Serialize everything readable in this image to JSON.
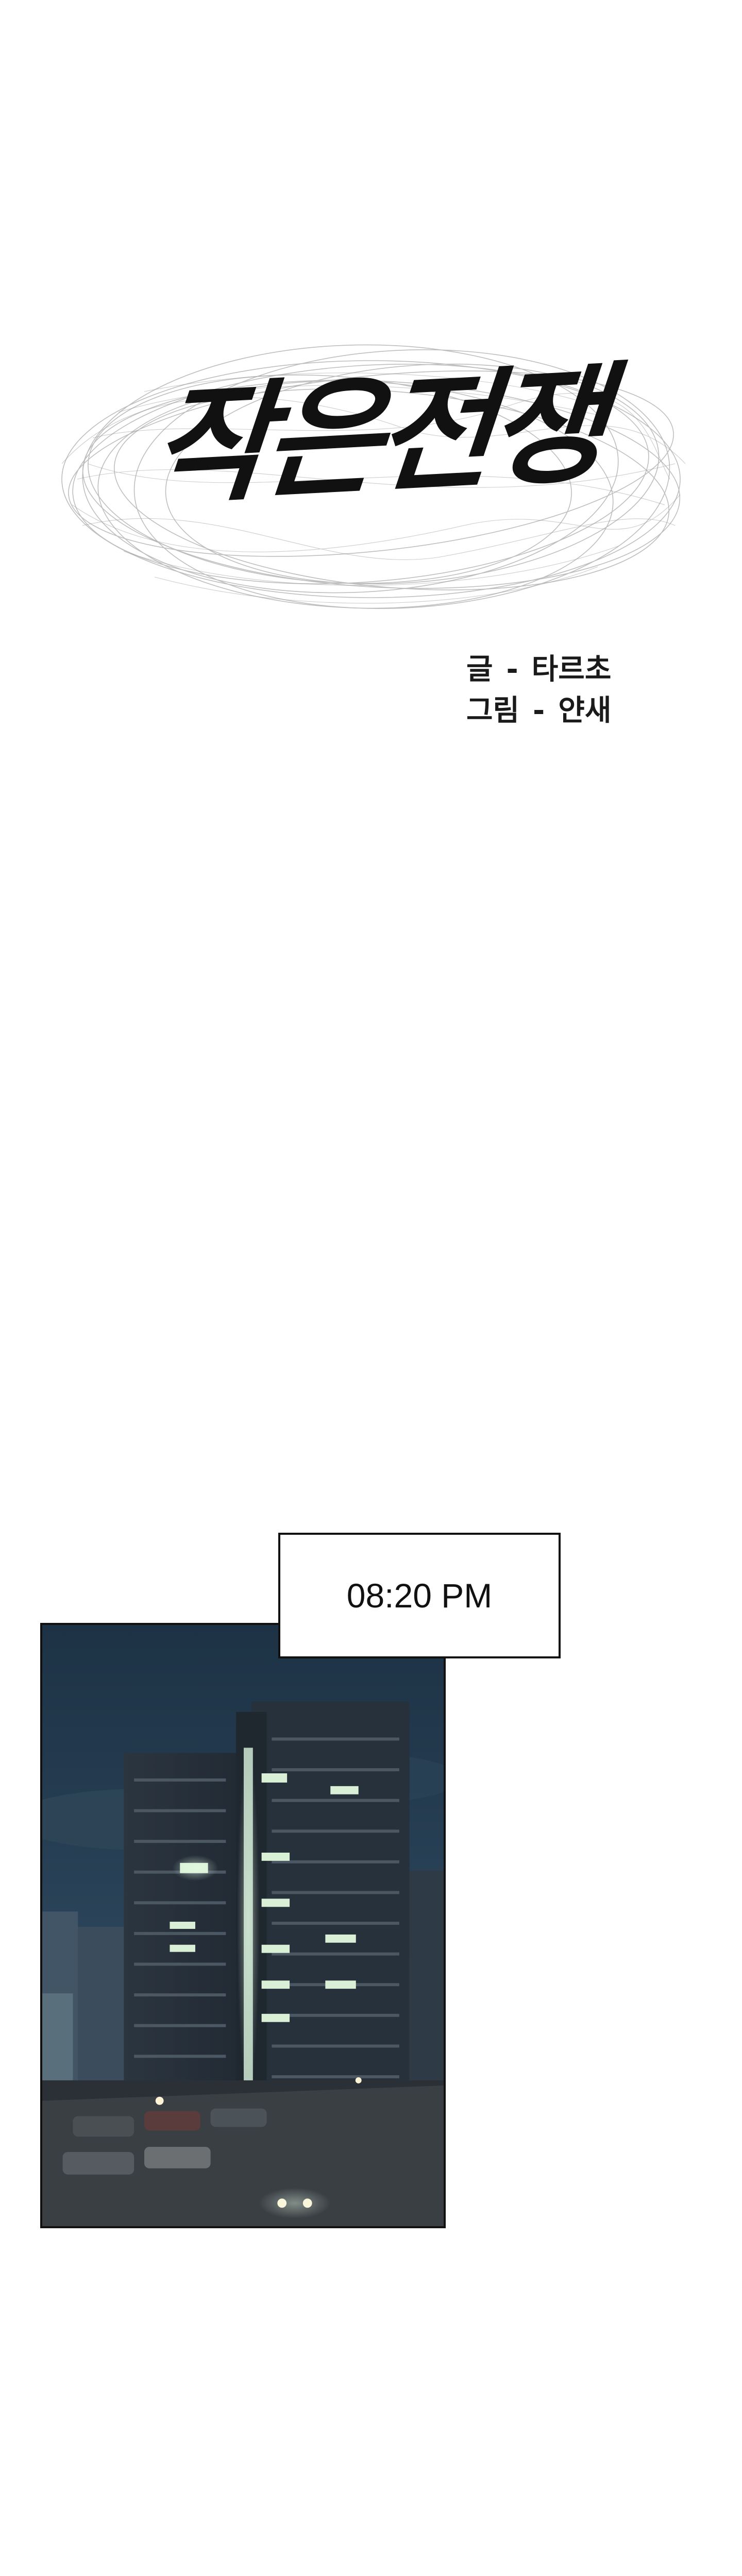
{
  "title": {
    "text": "작은전쟁"
  },
  "credits": [
    {
      "role": "글",
      "separator": "-",
      "name": "타르초"
    },
    {
      "role": "그림",
      "separator": "-",
      "name": "얀새"
    }
  ],
  "panel": {
    "caption": "08:20 PM",
    "scene": "night-apartment-building"
  },
  "colors": {
    "background": "#ffffff",
    "ink": "#111111",
    "night_sky": "#23374a",
    "window_light": "#cfe8d2"
  }
}
